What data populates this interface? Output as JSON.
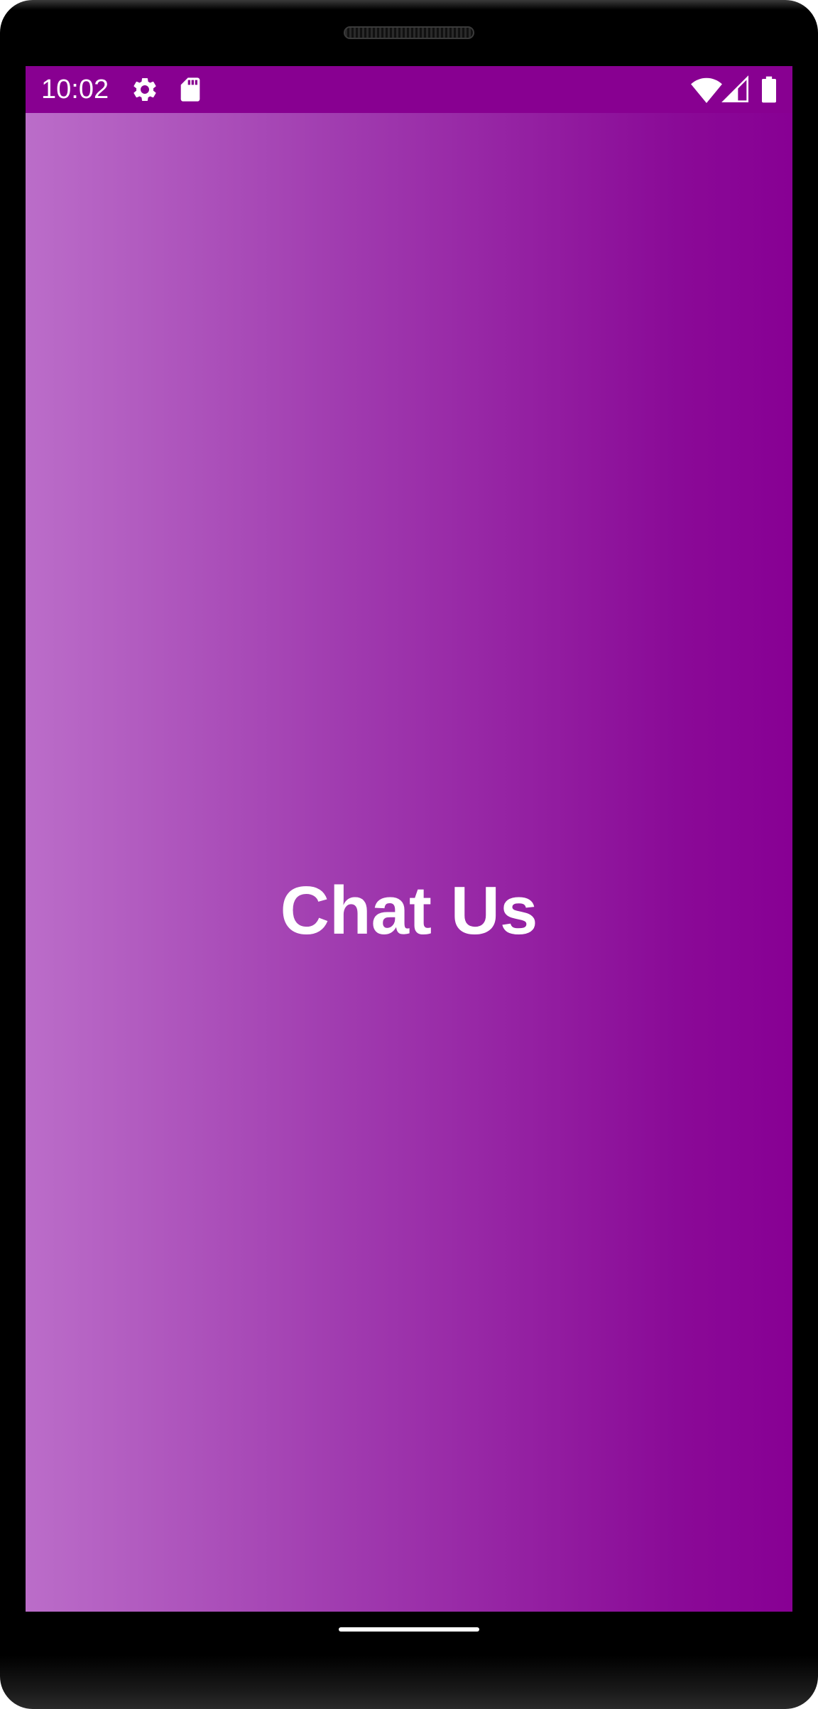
{
  "status_bar": {
    "time": "10:02",
    "background_color": "#880091",
    "icons_left": [
      "gear-icon",
      "sd-card-icon"
    ],
    "icons_right": [
      "wifi-icon",
      "cell-signal-icon",
      "battery-icon"
    ]
  },
  "main": {
    "title": "Chat Us",
    "gradient_colors": [
      "#bb6dc9",
      "#880094"
    ]
  }
}
